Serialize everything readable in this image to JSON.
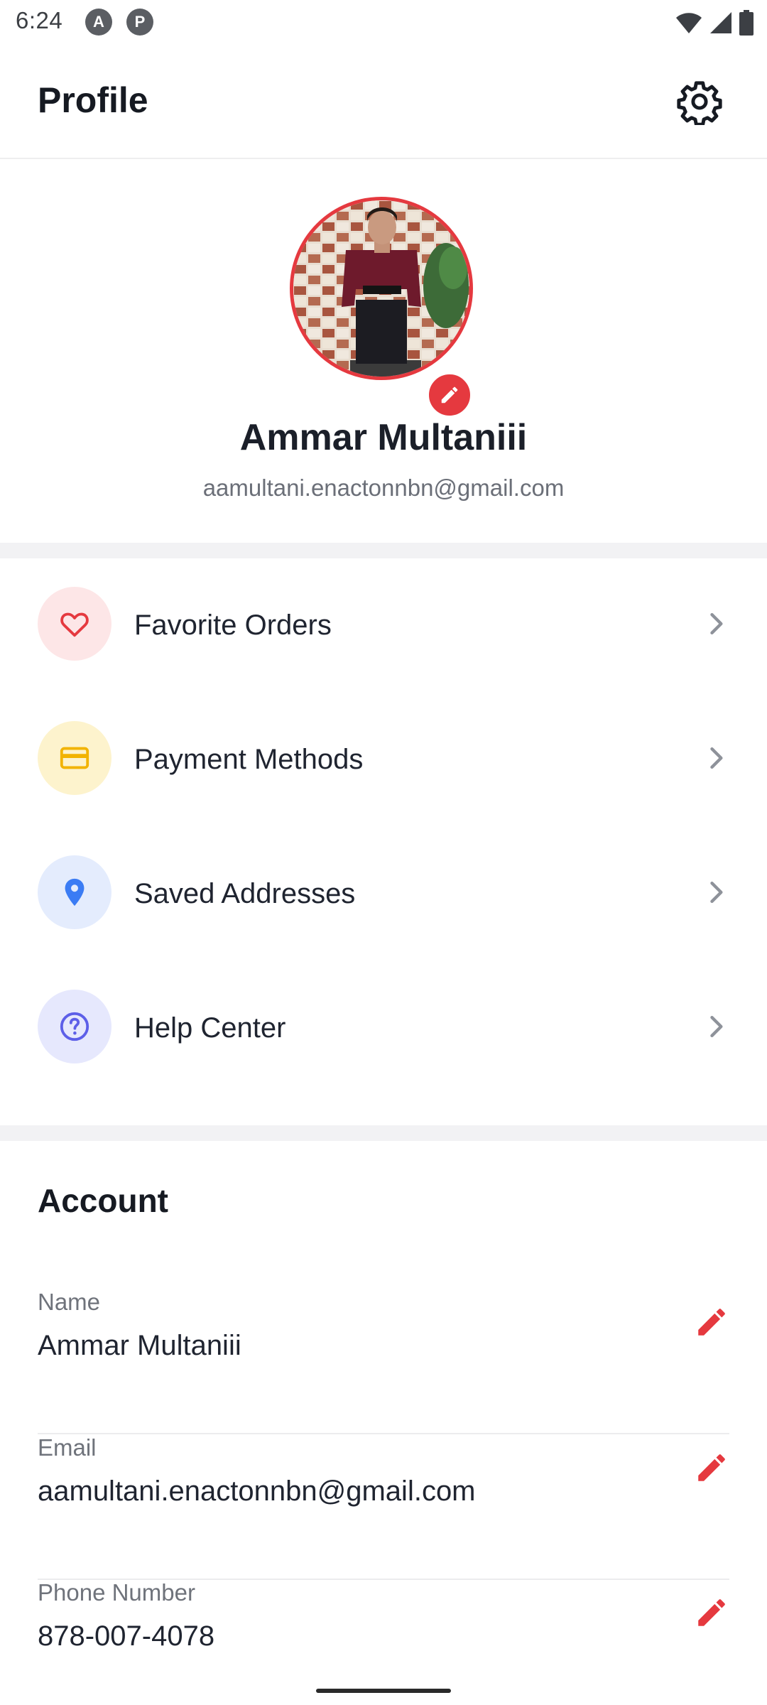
{
  "status_bar": {
    "time": "6:24",
    "app_icons": [
      "A",
      "P"
    ],
    "icons": [
      "wifi-icon",
      "cell-signal-icon",
      "battery-icon"
    ]
  },
  "app_bar": {
    "title": "Profile",
    "settings_icon": "gear-icon"
  },
  "profile": {
    "name": "Ammar Multaniii",
    "email": "aamultani.enactonnbn@gmail.com",
    "avatar_alt": "profile photo",
    "edit_icon": "pencil-icon"
  },
  "menu": {
    "items": [
      {
        "label": "Favorite Orders",
        "icon": "heart-icon",
        "icon_bg": "#fde6e7",
        "icon_color": "#e5393f"
      },
      {
        "label": "Payment Methods",
        "icon": "credit-card-icon",
        "icon_bg": "#fdf3cd",
        "icon_color": "#f2b300"
      },
      {
        "label": "Saved Addresses",
        "icon": "location-pin-icon",
        "icon_bg": "#e4ecfd",
        "icon_color": "#3b7cf4"
      },
      {
        "label": "Help Center",
        "icon": "question-circle-icon",
        "icon_bg": "#e6e8fd",
        "icon_color": "#5d5fe8"
      }
    ]
  },
  "account": {
    "title": "Account",
    "fields": [
      {
        "label": "Name",
        "value": "Ammar Multaniii"
      },
      {
        "label": "Email",
        "value": "aamultani.enactonnbn@gmail.com"
      },
      {
        "label": "Phone Number",
        "value": "878-007-4078"
      }
    ]
  },
  "colors": {
    "accent": "#e5393f",
    "text_primary": "#1f2430",
    "text_secondary": "#6f737b",
    "divider": "#f2f2f4"
  }
}
